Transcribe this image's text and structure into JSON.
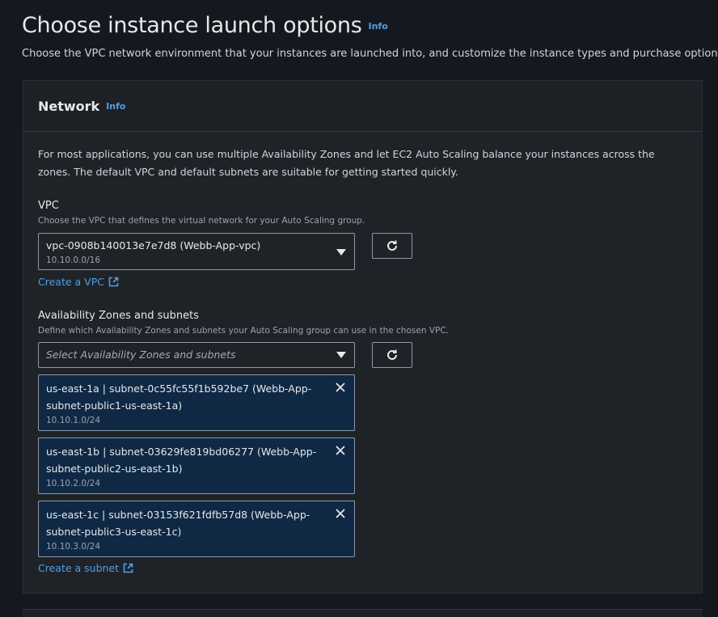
{
  "header": {
    "title": "Choose instance launch options",
    "info": "Info",
    "description": "Choose the VPC network environment that your instances are launched into, and customize the instance types and purchase options."
  },
  "network": {
    "title": "Network",
    "info": "Info",
    "intro": "For most applications, you can use multiple Availability Zones and let EC2 Auto Scaling balance your instances across the zones. The default VPC and default subnets are suitable for getting started quickly.",
    "vpc": {
      "label": "VPC",
      "description": "Choose the VPC that defines the virtual network for your Auto Scaling group.",
      "selected": "vpc-0908b140013e7e7d8 (Webb-App-vpc)",
      "cidr": "10.10.0.0/16",
      "create_link": "Create a VPC"
    },
    "subnets": {
      "label": "Availability Zones and subnets",
      "description": "Define which Availability Zones and subnets your Auto Scaling group can use in the chosen VPC.",
      "placeholder": "Select Availability Zones and subnets",
      "tokens": [
        {
          "label": "us-east-1a | subnet-0c55fc55f1b592be7 (Webb-App-subnet-public1-us-east-1a)",
          "cidr": "10.10.1.0/24"
        },
        {
          "label": "us-east-1b | subnet-03629fe819bd06277 (Webb-App-subnet-public2-us-east-1b)",
          "cidr": "10.10.2.0/24"
        },
        {
          "label": "us-east-1c | subnet-03153f621fdfb57d8 (Webb-App-subnet-public3-us-east-1c)",
          "cidr": "10.10.3.0/24"
        }
      ],
      "create_link": "Create a subnet"
    }
  },
  "colors": {
    "background": "#15191f",
    "panel": "#1f2328",
    "link": "#539fe5",
    "token_background": "#0f2945"
  }
}
